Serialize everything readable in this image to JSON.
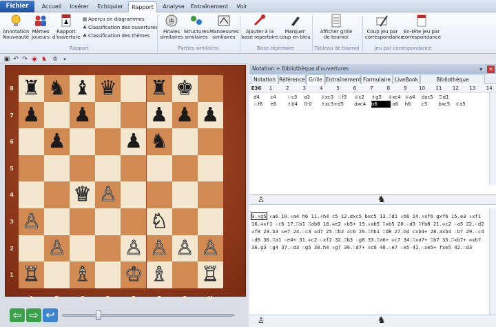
{
  "ribbon_tabs": [
    {
      "label": "Fichier",
      "key": "file"
    },
    {
      "label": "Accueil",
      "key": "home"
    },
    {
      "label": "Insérer",
      "key": "insert"
    },
    {
      "label": "Echiquier",
      "key": "board"
    },
    {
      "label": "Rapport",
      "key": "report"
    },
    {
      "label": "Analyse",
      "key": "analysis"
    },
    {
      "label": "Entraînement",
      "key": "training"
    },
    {
      "label": "Voir",
      "key": "view"
    }
  ],
  "active_tab": "Rapport",
  "ribbon": {
    "annotation_new": "Annotation Nouveauté",
    "same_players": "Mêmes Joueurs",
    "opening_report": "Rapport d'ouverture",
    "diagram_preview": "Aperçu en diagrammes",
    "opening_class": "Classification des ouvertures",
    "theme_class": "Classification des thèmes",
    "group_report": "Rapport",
    "similar_endings": "Finales similaires",
    "similar_structures": "Structures similaires",
    "similar_maneuvers": "Manoeuvres similaires",
    "group_similar": "Parties similaires",
    "add_repertoire": "Ajouter à la base répertoire",
    "mark_blue": "Marquer coup en bleu",
    "group_repertoire": "Base répertoire",
    "show_grid": "Afficher grille de tournoi",
    "group_tournament": "Tableau de tournoi",
    "move_by_corr": "Coup jeu par correspondance",
    "header_corr": "En-tête jeu par correspondance",
    "group_corr": "Jeu par correspondance"
  },
  "panel": {
    "title": "Notation + Bibliothèque d'ouvertures",
    "tabs": [
      "Notation",
      "Référence",
      "Grille",
      "Entraînement",
      "Formulaire",
      "LiveBook",
      "Bibliothèque d'ouvertures"
    ],
    "active_tab": "Grille"
  },
  "grid": {
    "eco": "E36",
    "headers": [
      "1",
      "2",
      "3",
      "4",
      "5",
      "6",
      "7",
      "8",
      "9",
      "10",
      "11",
      "12",
      "13",
      "14"
    ],
    "row1": [
      "d4",
      "c4",
      "♘c3",
      "a3",
      "♕xc3",
      "♘f3",
      "♕c2",
      "♗g5",
      "♕xc4",
      "♕a4",
      "dxc5",
      "♖d1"
    ],
    "row2": [
      "♘f6",
      "e6",
      "♗b4",
      "0-0",
      "♗xc3+",
      "d5",
      "dxc4",
      "b6",
      "♗a6",
      "h6",
      "c5",
      "bxc5",
      "♕a5"
    ],
    "highlight_cell": "b6"
  },
  "notation": {
    "lines": [
      "9.♗g5 ♗a6 10.♕a4 h6 11.♗h4 c5 12.dxc5 bxc5 13.♖d1 ♕b6 14.♗xf6 gxf6 15.e3 ♗xf1",
      "16.♔xf1 ♘c6 17.♖b1 ♖ab8 18.♔e2 ♕b5+ 19.♕xb5 ♖xb5 20.♘d3 ♖fb8 21.♔c2 ♘a5 22.♘d2",
      "♔f8 23.b3 ♔e7 24.♘c3 ♔d7 25.♖b2 ♔c6 26.♖hb1 ♖d8 27.b4 cxb4+ 28.axb4 ♘b7 29.♘c4",
      "♘d6 30.♖a1 ♘e4+ 31.♔c2 ♘xf2 32.♖b3 ♘g8 33.♖a6+ ♔c7 34.♖xa7+ ♖b7 35.♖xb7+ ♔xb7",
      "36.g3 ♘g4 37.♘d3 ♘g5 38.h4 ♕g7 39.♘d7+ ♔c6 40.♘e7 ♘e5 41.♘xe5+ fxe5 42.♘d3"
    ],
    "current_move": "9.♗g5"
  },
  "board": {
    "files": [
      "A",
      "B",
      "C",
      "D",
      "E",
      "F",
      "G",
      "H"
    ],
    "ranks": [
      "8",
      "7",
      "6",
      "5",
      "4",
      "3",
      "2",
      "1"
    ],
    "pieces": [
      {
        "sq": "a8",
        "p": "♜",
        "c": "b"
      },
      {
        "sq": "b8",
        "p": "♞",
        "c": "b"
      },
      {
        "sq": "c8",
        "p": "♝",
        "c": "b"
      },
      {
        "sq": "d8",
        "p": "♛",
        "c": "b"
      },
      {
        "sq": "f8",
        "p": "♜",
        "c": "b"
      },
      {
        "sq": "g8",
        "p": "♚",
        "c": "b"
      },
      {
        "sq": "a7",
        "p": "♟",
        "c": "b"
      },
      {
        "sq": "c7",
        "p": "♟",
        "c": "b"
      },
      {
        "sq": "f7",
        "p": "♟",
        "c": "b"
      },
      {
        "sq": "g7",
        "p": "♟",
        "c": "b"
      },
      {
        "sq": "h7",
        "p": "♟",
        "c": "b"
      },
      {
        "sq": "b6",
        "p": "♟",
        "c": "b"
      },
      {
        "sq": "e6",
        "p": "♟",
        "c": "b"
      },
      {
        "sq": "f6",
        "p": "♞",
        "c": "b"
      },
      {
        "sq": "c4",
        "p": "♕",
        "c": "w"
      },
      {
        "sq": "d4",
        "p": "♙",
        "c": "w"
      },
      {
        "sq": "a3",
        "p": "♙",
        "c": "w"
      },
      {
        "sq": "f3",
        "p": "♘",
        "c": "w"
      },
      {
        "sq": "b2",
        "p": "♙",
        "c": "w"
      },
      {
        "sq": "e2",
        "p": "♙",
        "c": "w"
      },
      {
        "sq": "f2",
        "p": "♙",
        "c": "w"
      },
      {
        "sq": "g2",
        "p": "♙",
        "c": "w"
      },
      {
        "sq": "h2",
        "p": "♙",
        "c": "w"
      },
      {
        "sq": "a1",
        "p": "♖",
        "c": "w"
      },
      {
        "sq": "c1",
        "p": "♗",
        "c": "w"
      },
      {
        "sq": "e1",
        "p": "♔",
        "c": "w"
      },
      {
        "sq": "f1",
        "p": "♗",
        "c": "w"
      },
      {
        "sq": "h1",
        "p": "♖",
        "c": "w"
      }
    ]
  },
  "colors": {
    "accent": "#1d4f9e",
    "light_square": "#f4e7cf",
    "dark_square": "#d08a52"
  }
}
